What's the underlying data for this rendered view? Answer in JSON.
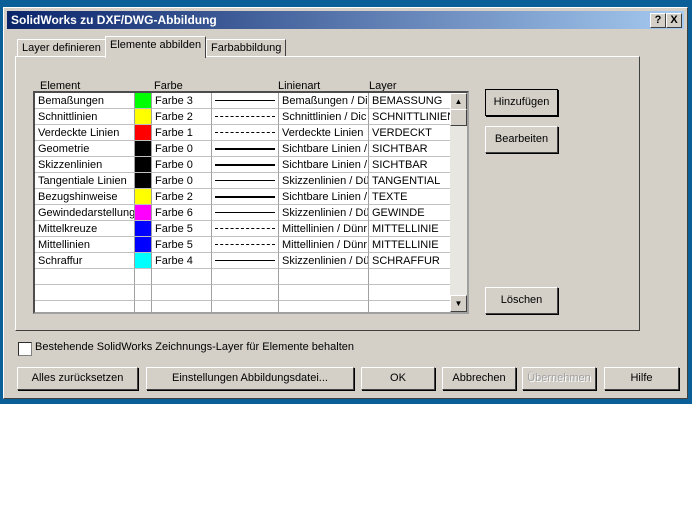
{
  "title": "SolidWorks zu DXF/DWG-Abbildung",
  "title_buttons": {
    "help": "?",
    "close": "X"
  },
  "tabs": [
    "Layer definieren",
    "Elemente abbilden",
    "Farbabbildung"
  ],
  "columns": [
    "Element",
    "Farbe",
    "Linienart",
    "Layer"
  ],
  "rows": [
    {
      "element": "Bemaßungen",
      "color": "#00ff00",
      "farbe": "Farbe 3",
      "style": "solid",
      "linienart": "Bemaßungen / Di",
      "layer": "BEMASSUNG"
    },
    {
      "element": "Schnittlinien",
      "color": "#ffff00",
      "farbe": "Farbe 2",
      "style": "dashed",
      "linienart": "Schnittlinien / Dic",
      "layer": "SCHNITTLINIEN"
    },
    {
      "element": "Verdeckte Linien",
      "color": "#ff0000",
      "farbe": "Farbe 1",
      "style": "dashed",
      "linienart": "Verdeckte Linien",
      "layer": "VERDECKT"
    },
    {
      "element": "Geometrie",
      "color": "#000000",
      "farbe": "Farbe 0",
      "style": "thick",
      "linienart": "Sichtbare Linien /",
      "layer": "SICHTBAR"
    },
    {
      "element": "Skizzenlinien",
      "color": "#000000",
      "farbe": "Farbe 0",
      "style": "thick",
      "linienart": "Sichtbare Linien /",
      "layer": "SICHTBAR"
    },
    {
      "element": "Tangentiale Linien",
      "color": "#000000",
      "farbe": "Farbe 0",
      "style": "solid",
      "linienart": "Skizzenlinien / Dü",
      "layer": "TANGENTIAL"
    },
    {
      "element": "Bezugshinweise",
      "color": "#ffff00",
      "farbe": "Farbe 2",
      "style": "thick",
      "linienart": "Sichtbare Linien /",
      "layer": "TEXTE"
    },
    {
      "element": "Gewindedarstellung",
      "color": "#ff00ff",
      "farbe": "Farbe 6",
      "style": "solid",
      "linienart": "Skizzenlinien / Dü",
      "layer": "GEWINDE"
    },
    {
      "element": "Mittelkreuze",
      "color": "#0000ff",
      "farbe": "Farbe 5",
      "style": "dashdot",
      "linienart": "Mittellinien / Dünr",
      "layer": "MITTELLINIE"
    },
    {
      "element": "Mittellinien",
      "color": "#0000ff",
      "farbe": "Farbe 5",
      "style": "dashdot",
      "linienart": "Mittellinien / Dünr",
      "layer": "MITTELLINIE"
    },
    {
      "element": "Schraffur",
      "color": "#00ffff",
      "farbe": "Farbe 4",
      "style": "solid",
      "linienart": "Skizzenlinien / Dü",
      "layer": "SCHRAFFUR"
    }
  ],
  "side_buttons": {
    "add": "Hinzufügen",
    "edit": "Bearbeiten",
    "delete": "Löschen"
  },
  "checkbox": {
    "label": "Bestehende SolidWorks Zeichnungs-Layer für Elemente behalten",
    "checked": false
  },
  "bottom_buttons": {
    "reset": "Alles zurücksetzen",
    "settings": "Einstellungen Abbildungsdatei...",
    "ok": "OK",
    "cancel": "Abbrechen",
    "apply": "Übernehmen",
    "help": "Hilfe"
  }
}
